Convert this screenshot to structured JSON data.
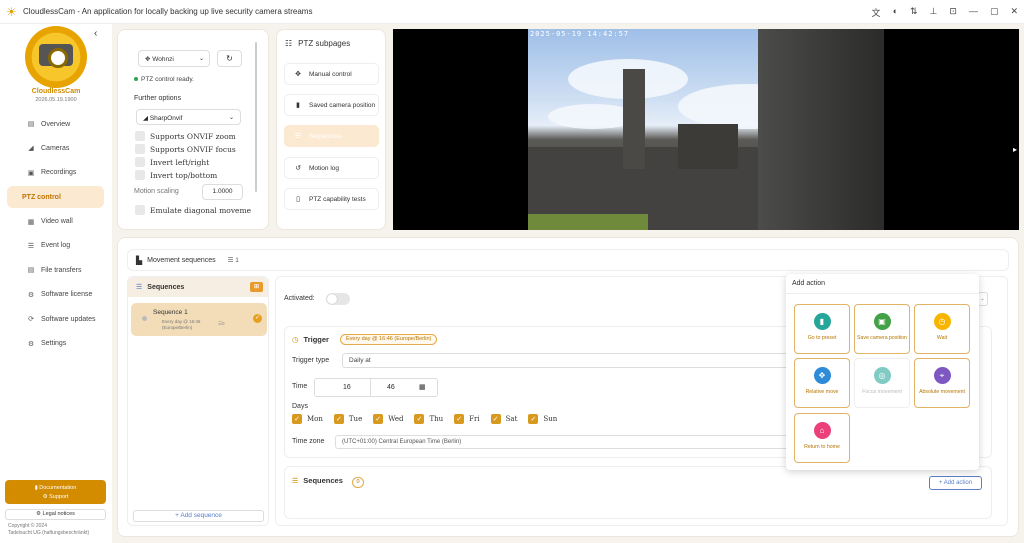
{
  "window": {
    "title": "CloudlessCam - An application for locally backing up live security camera streams",
    "controls": [
      "文A",
      "⛒",
      "⇅",
      "⏷",
      "⊡",
      "—",
      "▢",
      "✕"
    ]
  },
  "sidebar": {
    "brand": "CloudlessCam",
    "version_date": "2026.05.19.1900",
    "items": [
      {
        "label": "Overview",
        "icon": "overview-icon",
        "glyph": "▤"
      },
      {
        "label": "Cameras",
        "icon": "camera-icon",
        "glyph": "◢"
      },
      {
        "label": "Recordings",
        "icon": "recordings-icon",
        "glyph": "▣"
      },
      {
        "label": "PTZ control",
        "icon": "ptz-icon",
        "glyph": "",
        "active": true
      },
      {
        "label": "Video wall",
        "icon": "video-wall-icon",
        "glyph": "▦"
      },
      {
        "label": "Event log",
        "icon": "event-log-icon",
        "glyph": "☰"
      },
      {
        "label": "File transfers",
        "icon": "file-transfers-icon",
        "glyph": "▤"
      },
      {
        "label": "Software license",
        "icon": "license-icon",
        "glyph": "⚙"
      },
      {
        "label": "Software updates",
        "icon": "updates-icon",
        "glyph": "⟳"
      },
      {
        "label": "Settings",
        "icon": "settings-icon",
        "glyph": "⚙"
      }
    ],
    "documentation": "Documentation",
    "support": "Support",
    "legal": "Legal notices",
    "copyright_line1": "Copyright © 2024",
    "copyright_line2": "Tadelsucht UG (haftungsbeschränkt)"
  },
  "ptz": {
    "camera_select": "Wohnzi",
    "status": "PTZ control ready.",
    "further_options": "Further options",
    "driver": "SharpOnvif",
    "options": [
      {
        "label": "Supports ONVIF zoom",
        "checked": false
      },
      {
        "label": "Supports ONVIF focus",
        "checked": false
      },
      {
        "label": "Invert left/right",
        "checked": false
      },
      {
        "label": "Invert top/bottom",
        "checked": false
      }
    ],
    "motion_scaling_label": "Motion scaling",
    "motion_scaling_value": "1.0000",
    "emulate_diagonal": "Emulate diagonal moveme"
  },
  "subpages": {
    "title": "PTZ subpages",
    "items": [
      {
        "label": "Manual control",
        "icon": "move-icon",
        "glyph": "✥"
      },
      {
        "label": "Saved camera position",
        "icon": "bookmark-icon",
        "glyph": "▮"
      },
      {
        "label": "Sequences",
        "icon": "sequences-icon",
        "glyph": "☰",
        "active": true
      },
      {
        "label": "Motion log",
        "icon": "history-icon",
        "glyph": "↺"
      },
      {
        "label": "PTZ capability tests",
        "icon": "test-icon",
        "glyph": "▯"
      }
    ]
  },
  "camera": {
    "timestamp": "2025-05-19 14:42:57"
  },
  "movement": {
    "header": "Movement sequences",
    "count": "1",
    "list_title": "Sequences",
    "sequence_name": "Sequence 1",
    "sequence_schedule_1": "Every day @ 16:46",
    "sequence_schedule_2": "(Europe/Berlin)",
    "sequence_count": "0",
    "add_sequence": "+ Add sequence"
  },
  "detail": {
    "activated": "Activated:",
    "trigger": "Trigger",
    "trigger_badge": "Every day @ 16:46 (Europe/Berlin)",
    "trigger_type_label": "Trigger type",
    "trigger_type": "Daily at",
    "time_label": "Time",
    "hour": "16",
    "minute": "46",
    "days_label": "Days",
    "days": [
      "Mon",
      "Tue",
      "Wed",
      "Thu",
      "Fri",
      "Sat",
      "Sun"
    ],
    "timezone_label": "Time zone",
    "timezone": "(UTC+01:00) Central European Time (Berlin)",
    "sequences": "Sequences",
    "sequences_count": "0",
    "add_action": "+ Add action"
  },
  "popup": {
    "title": "Add action",
    "actions": [
      {
        "label": "Go to preset",
        "icon": "bookmark-icon",
        "glyph": "▮",
        "color": "#26a69a",
        "enabled": true
      },
      {
        "label": "Save camera position",
        "icon": "save-icon",
        "glyph": "▣",
        "color": "#43a047",
        "enabled": true
      },
      {
        "label": "Wait",
        "icon": "timer-icon",
        "glyph": "◷",
        "color": "#f7b500",
        "enabled": true
      },
      {
        "label": "Relative move",
        "icon": "move-icon",
        "glyph": "✥",
        "color": "#2e8bd8",
        "enabled": true
      },
      {
        "label": "Focus movement",
        "icon": "focus-icon",
        "glyph": "◎",
        "color": "#80cbc4",
        "enabled": false
      },
      {
        "label": "Absolute movement",
        "icon": "target-icon",
        "glyph": "⌖",
        "color": "#7e57c2",
        "enabled": true
      },
      {
        "label": "Return to home",
        "icon": "home-icon",
        "glyph": "⌂",
        "color": "#ec407a",
        "enabled": true
      }
    ]
  },
  "colors": {
    "accent": "#d38b00",
    "active_bg": "#fbe9d2",
    "link_blue": "#5b7ec7"
  }
}
